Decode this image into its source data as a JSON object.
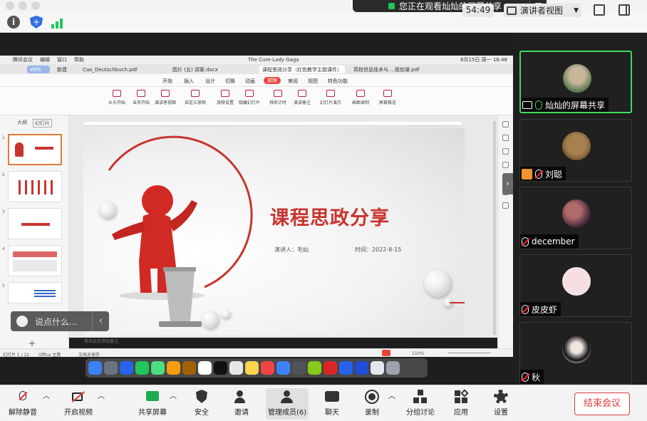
{
  "top": {
    "share_notice": "您正在观看灿灿的屏幕共享",
    "timer": "54:49",
    "view_mode": "演讲者视图"
  },
  "shared_screen": {
    "mac_menu": [
      "腾讯会议",
      "编辑",
      "窗口",
      "帮助"
    ],
    "now_playing": "The Cure-Lady Gaga",
    "clock": "8月15日 周一 16:48",
    "file_tabs": [
      "WPS",
      "新建",
      "Cao_Deutschbuch.pdf",
      "图片 (五) 讲案.docx",
      "课程思政分享（红色教学主题课件）",
      "高校信息技术与....规划课.pdf"
    ],
    "ribbon_tabs": [
      "开始",
      "插入",
      "设计",
      "切换",
      "动画",
      "放映",
      "审阅",
      "视图",
      "特色功能"
    ],
    "ribbon_active_tab": "放映",
    "ribbon_buttons": [
      "从头开始",
      "当页开始",
      "演讲者视图",
      "自定义放映",
      "放映设置",
      "隐藏幻灯片",
      "排练计时",
      "演讲备注",
      "幻灯片演示",
      "画面录制",
      "屏幕推送"
    ],
    "left_panel_tabs": [
      "大纲",
      "幻灯片"
    ],
    "slide": {
      "title": "课程思政分享",
      "presenter": "演讲人：毛灿",
      "date": "时间：2022-8-15"
    },
    "notes_placeholder": "单击此处添加备注",
    "status": {
      "slide_count": "幻灯片 1 / 22",
      "theme": "Office 主题",
      "backup": "文档未保存",
      "zoom": "110%"
    }
  },
  "chat": {
    "placeholder": "说点什么..."
  },
  "participants": [
    {
      "name": "灿灿的屏幕共享",
      "active": true
    },
    {
      "name": "刘聪",
      "active": false
    },
    {
      "name": "december",
      "active": false
    },
    {
      "name": "皮皮虾",
      "active": false
    },
    {
      "name": "秋",
      "active": false
    }
  ],
  "bottom_bar": {
    "unmute": "解除静音",
    "video": "开启视频",
    "share": "共享屏幕",
    "security": "安全",
    "invite": "邀请",
    "manage": "管理成员(6)",
    "chat": "聊天",
    "record": "录制",
    "breakout": "分组讨论",
    "apps": "应用",
    "settings": "设置",
    "end": "结束会议"
  },
  "colors": {
    "accent_green": "#3ddc5a",
    "title_red": "#c8342f",
    "end_red": "#e03b3b"
  }
}
